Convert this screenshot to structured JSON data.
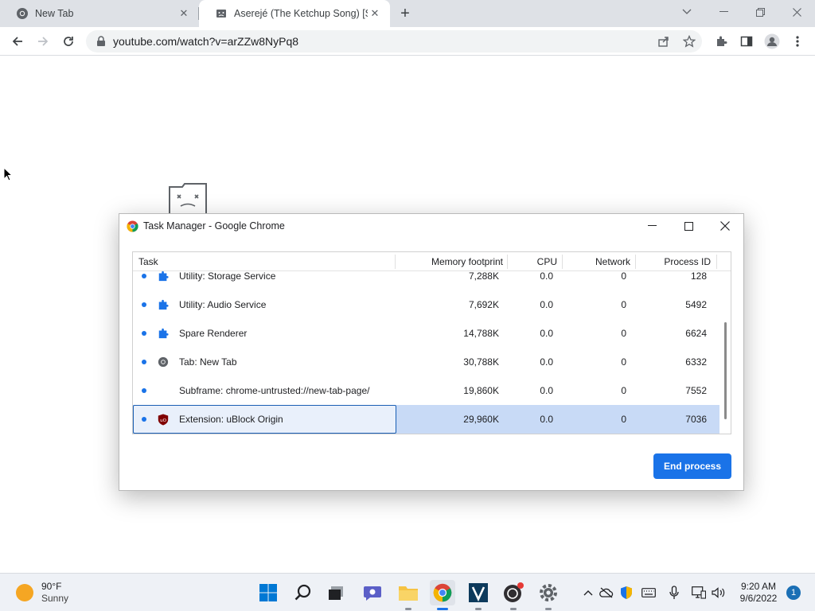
{
  "browser": {
    "tabs": [
      {
        "title": "New Tab",
        "icon": "chrome-icon"
      },
      {
        "title": "Aserejé (The Ketchup Song) [Spa",
        "icon": "sad-tab-icon"
      }
    ],
    "url": "youtube.com/watch?v=arZZw8NyPq8"
  },
  "task_manager": {
    "title": "Task Manager - Google Chrome",
    "columns": {
      "task": "Task",
      "memory": "Memory footprint",
      "cpu": "CPU",
      "network": "Network",
      "pid": "Process ID"
    },
    "rows": [
      {
        "task": "Utility: Storage Service",
        "icon": "puzzle-icon",
        "memory": "7,288K",
        "cpu": "0.0",
        "network": "0",
        "pid": "128"
      },
      {
        "task": "Utility: Audio Service",
        "icon": "puzzle-icon",
        "memory": "7,692K",
        "cpu": "0.0",
        "network": "0",
        "pid": "5492"
      },
      {
        "task": "Spare Renderer",
        "icon": "puzzle-icon",
        "memory": "14,788K",
        "cpu": "0.0",
        "network": "0",
        "pid": "6624"
      },
      {
        "task": "Tab: New Tab",
        "icon": "chrome-icon",
        "memory": "30,788K",
        "cpu": "0.0",
        "network": "0",
        "pid": "6332"
      },
      {
        "task": "Subframe: chrome-untrusted://new-tab-page/",
        "icon": "",
        "memory": "19,860K",
        "cpu": "0.0",
        "network": "0",
        "pid": "7552"
      },
      {
        "task": "Extension: uBlock Origin",
        "icon": "ublock-icon",
        "memory": "29,960K",
        "cpu": "0.0",
        "network": "0",
        "pid": "7036"
      }
    ],
    "selected_row": "Extension: uBlock Origin",
    "end_process_label": "End process"
  },
  "taskbar": {
    "weather_temp": "90°F",
    "weather_condition": "Sunny",
    "time": "9:20 AM",
    "date": "9/6/2022",
    "notification_count": "1"
  },
  "colors": {
    "accent": "#1a73e8",
    "selection": "#c8daf6"
  }
}
